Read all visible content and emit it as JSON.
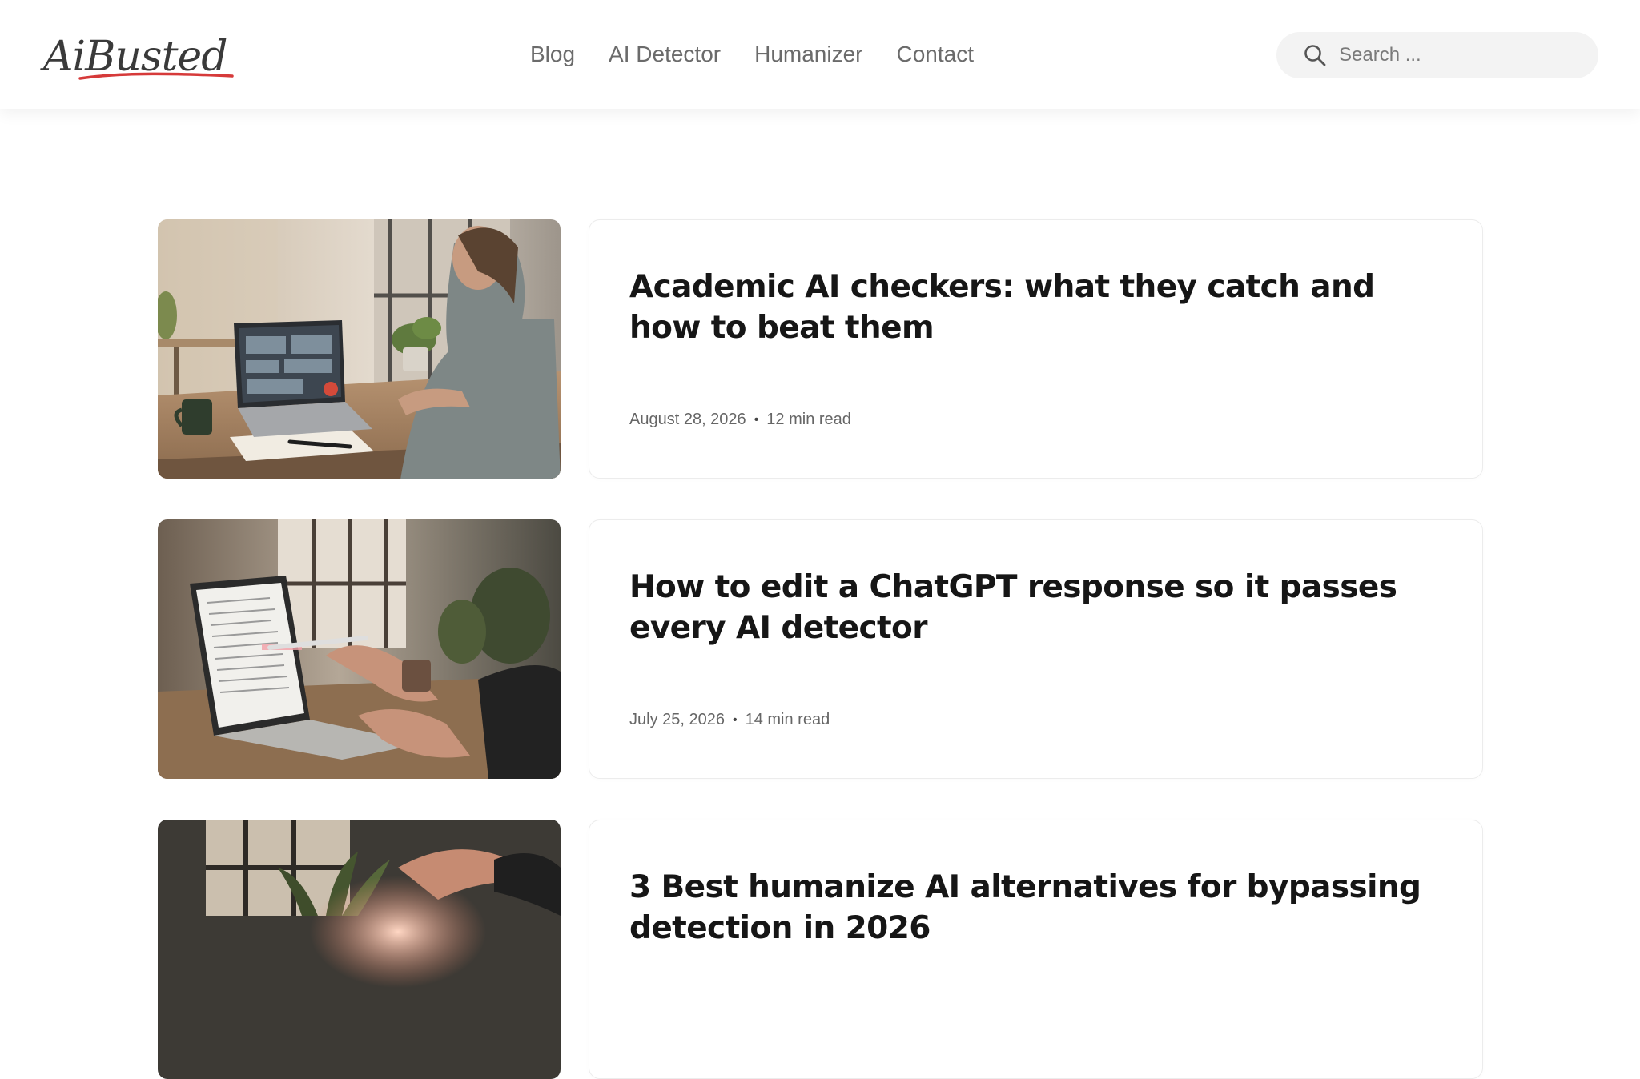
{
  "site": {
    "logo_text": "AiBusted",
    "accent_color": "#d63a3a"
  },
  "nav": {
    "items": [
      {
        "label": "Blog"
      },
      {
        "label": "AI Detector"
      },
      {
        "label": "Humanizer"
      },
      {
        "label": "Contact"
      }
    ]
  },
  "search": {
    "placeholder": "Search ...",
    "icon": "search-icon"
  },
  "posts": [
    {
      "title": "Academic AI checkers: what they catch and how to beat them",
      "date": "August 28, 2026",
      "read_time": "12 min read",
      "separator": "•",
      "image": "woman-at-laptop-with-analytics-dashboard"
    },
    {
      "title": "How to edit a ChatGPT response so it passes every AI detector",
      "date": "July 25, 2026",
      "read_time": "14 min read",
      "separator": "•",
      "image": "hand-with-pen-at-laptop-document"
    },
    {
      "title": "3 Best humanize AI alternatives for bypassing detection in 2026",
      "date": "",
      "read_time": "",
      "separator": "",
      "image": "hands-around-glowing-brain"
    }
  ]
}
